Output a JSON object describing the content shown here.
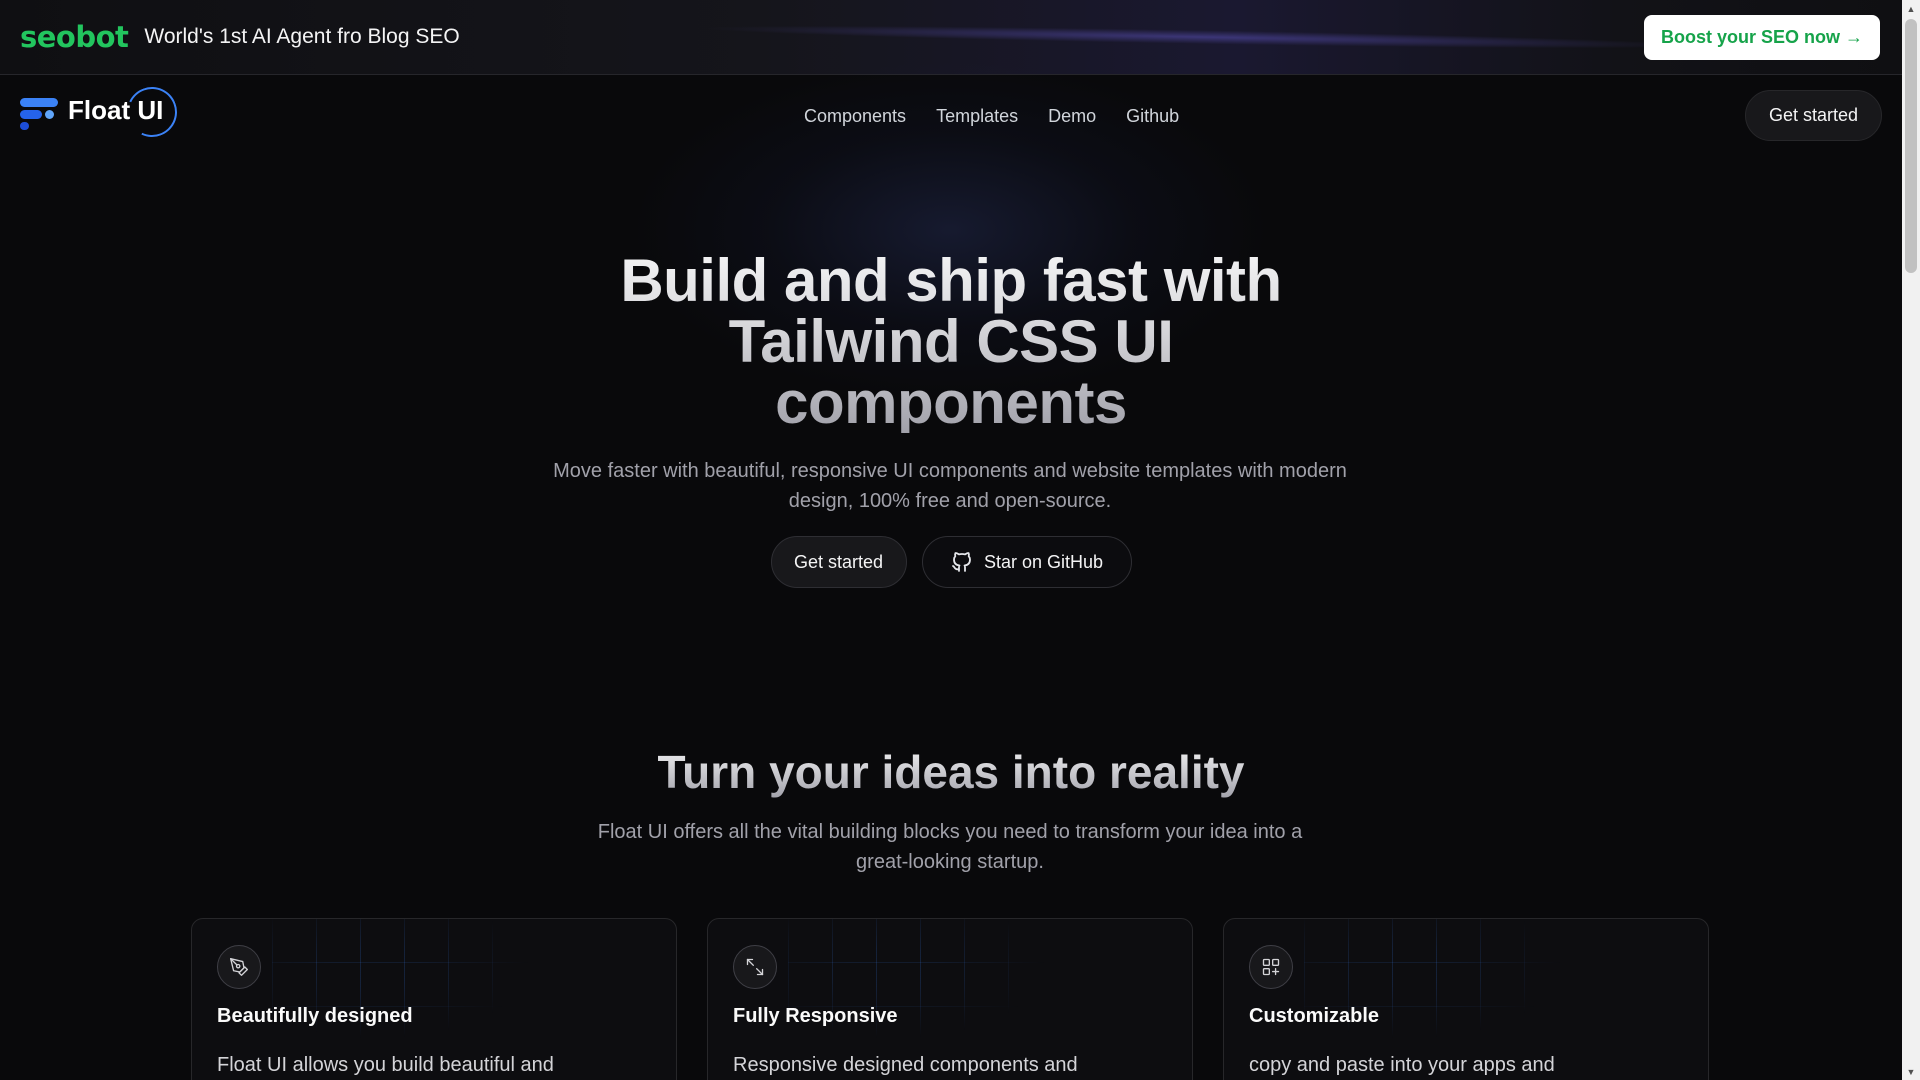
{
  "banner": {
    "logo": "seobot",
    "text": "World's 1st AI Agent fro Blog SEO",
    "cta": "Boost your SEO now →"
  },
  "nav": {
    "brand": "Float UI",
    "links": [
      "Components",
      "Templates",
      "Demo",
      "Github"
    ],
    "cta": "Get started"
  },
  "hero": {
    "title_lines": [
      "Build and ship fast with",
      "Tailwind CSS UI",
      "components"
    ],
    "subtitle": "Move faster with beautiful, responsive UI components and website templates with modern design, 100% free and open-source.",
    "primary_cta": "Get started",
    "secondary_cta": "Star on GitHub"
  },
  "features": {
    "title": "Turn your ideas into reality",
    "subtitle": "Float UI offers all the vital building blocks you need to transform your idea into a great-looking startup.",
    "cards": [
      {
        "icon": "pen-tool-icon",
        "title": "Beautifully designed",
        "text": "Float UI allows you build beautiful and"
      },
      {
        "icon": "expand-arrows-icon",
        "title": "Fully Responsive",
        "text": "Responsive designed components and"
      },
      {
        "icon": "grid-plus-icon",
        "title": "Customizable",
        "text": "copy and paste into your apps and"
      }
    ]
  },
  "colors": {
    "background": "#09090b",
    "seobot_green": "#22c55e",
    "brand_blue": "#3b82f6"
  }
}
